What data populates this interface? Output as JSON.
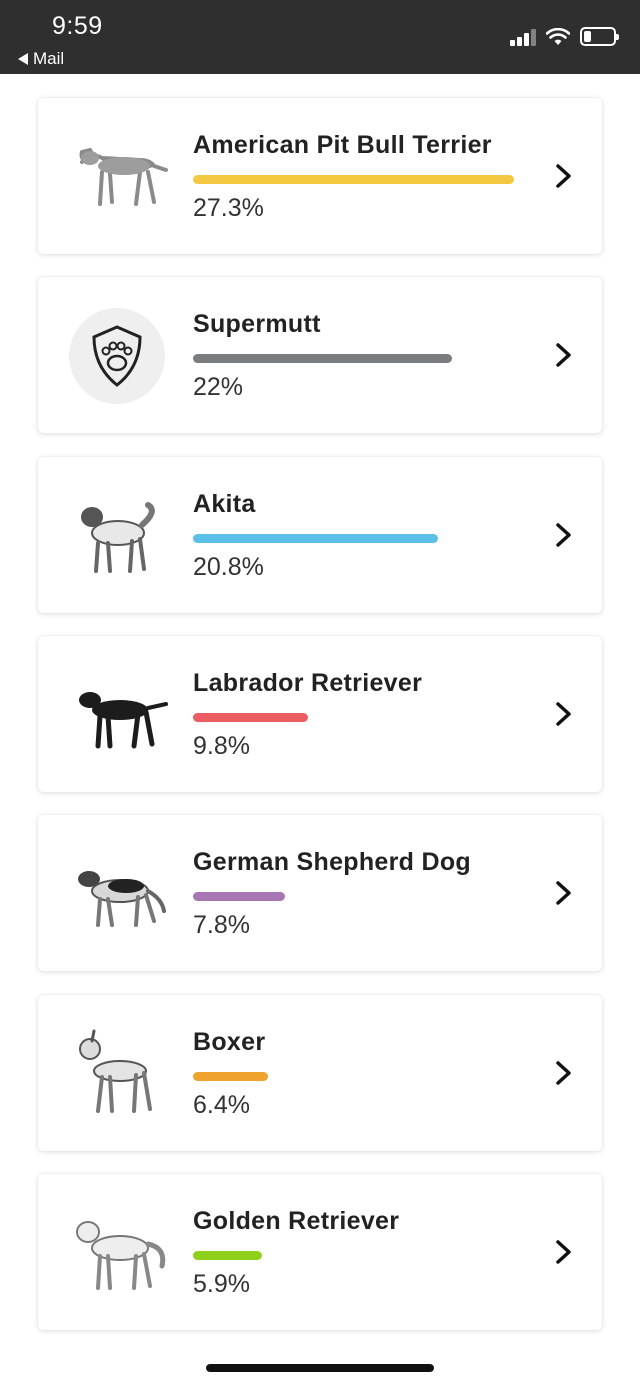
{
  "status_bar": {
    "time": "9:59",
    "back_label": "Mail"
  },
  "breeds": [
    {
      "name": "American Pit Bull Terrier",
      "percent_text": "27.3%",
      "percent": 27.3,
      "color": "#f5c842",
      "icon": "pit-bull-icon"
    },
    {
      "name": "Supermutt",
      "percent_text": "22%",
      "percent": 22.0,
      "color": "#7a7d80",
      "icon": "paw-shield-icon"
    },
    {
      "name": "Akita",
      "percent_text": "20.8%",
      "percent": 20.8,
      "color": "#5bbfe8",
      "icon": "akita-icon"
    },
    {
      "name": "Labrador Retriever",
      "percent_text": "9.8%",
      "percent": 9.8,
      "color": "#ec5d63",
      "icon": "labrador-icon"
    },
    {
      "name": "German Shepherd Dog",
      "percent_text": "7.8%",
      "percent": 7.8,
      "color": "#a876b5",
      "icon": "german-shepherd-icon"
    },
    {
      "name": "Boxer",
      "percent_text": "6.4%",
      "percent": 6.4,
      "color": "#f0a22e",
      "icon": "boxer-icon"
    },
    {
      "name": "Golden Retriever",
      "percent_text": "5.9%",
      "percent": 5.9,
      "color": "#8fd11a",
      "icon": "golden-retriever-icon"
    }
  ]
}
